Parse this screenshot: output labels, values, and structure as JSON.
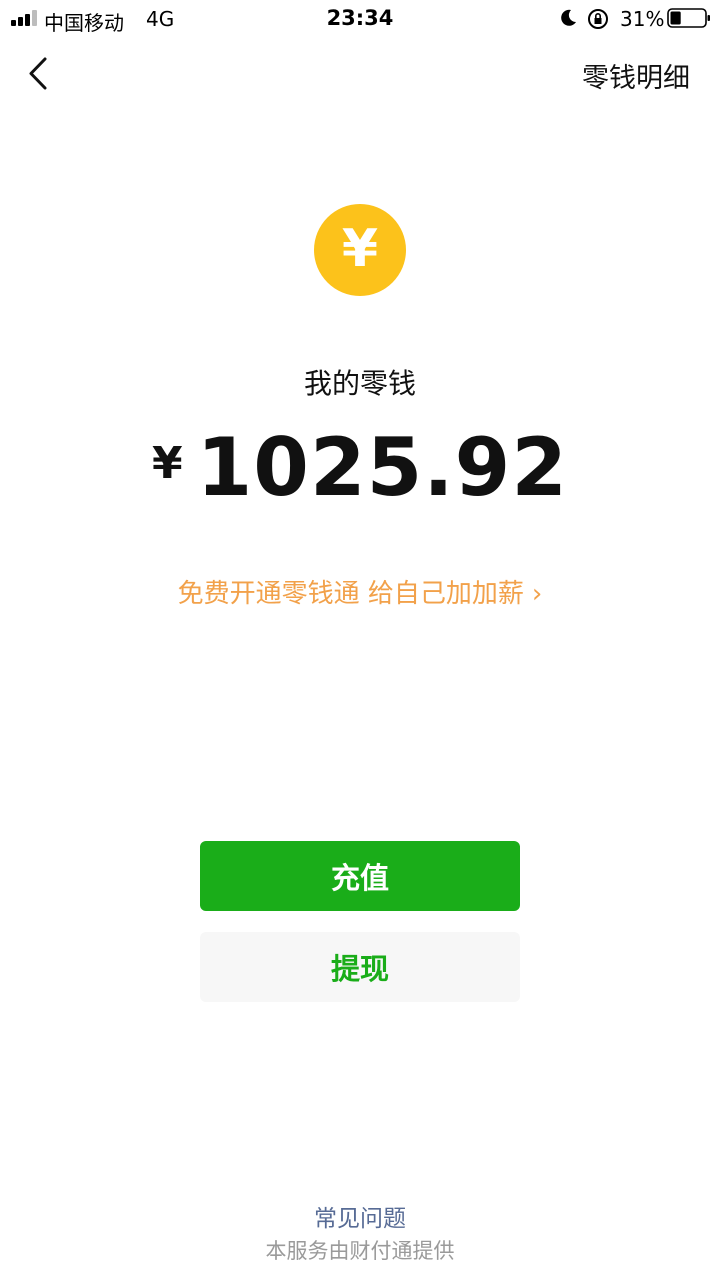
{
  "status_bar": {
    "carrier": "中国移动",
    "network": "4G",
    "time": "23:34",
    "battery": "31%",
    "battery_level": 0.31
  },
  "nav": {
    "back_icon": "chevron-left-icon",
    "right_link": "零钱明细"
  },
  "wallet": {
    "coin_icon": "yuan-coin-icon",
    "coin_symbol": "¥",
    "coin_color": "#fcc21b",
    "title": "我的零钱",
    "currency_symbol": "¥",
    "balance": "1025.92"
  },
  "promo": {
    "text": "免费开通零钱通 给自己加加薪",
    "chevron": "›",
    "color": "#f2a14a"
  },
  "actions": {
    "recharge_label": "充值",
    "withdraw_label": "提现",
    "primary_color": "#1aad19"
  },
  "footer": {
    "faq_label": "常见问题",
    "provider_text": "本服务由财付通提供"
  }
}
